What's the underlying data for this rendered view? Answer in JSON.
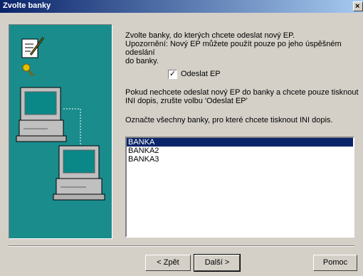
{
  "window": {
    "title": "Zvolte banky",
    "close_glyph": "×"
  },
  "intro": {
    "line1": "Zvolte banky, do kterých chcete odeslat nový EP.",
    "line2": "Upozornění: Nový EP můžete použít pouze po jeho úspěšném odeslání",
    "line3": "do banky."
  },
  "send_ep": {
    "label": "Odeslat EP",
    "checked": true,
    "check_glyph": "✓"
  },
  "ini_note": {
    "line1": "Pokud nechcete odeslat nový EP do banky a chcete pouze tisknout",
    "line2": "INI dopis, zrušte volbu 'Odeslat EP'"
  },
  "select_prompt": "Označte všechny banky, pro které chcete tisknout INI dopis.",
  "banks": [
    {
      "name": "BANKA",
      "selected": true
    },
    {
      "name": "BANKA2",
      "selected": false
    },
    {
      "name": "BANKA3",
      "selected": false
    }
  ],
  "buttons": {
    "back": "< Zpět",
    "next": "Další >",
    "help": "Pomoc"
  },
  "icons": [
    "document-pen-icon",
    "key-icon",
    "computer-icon",
    "computer-icon",
    "network-line"
  ]
}
